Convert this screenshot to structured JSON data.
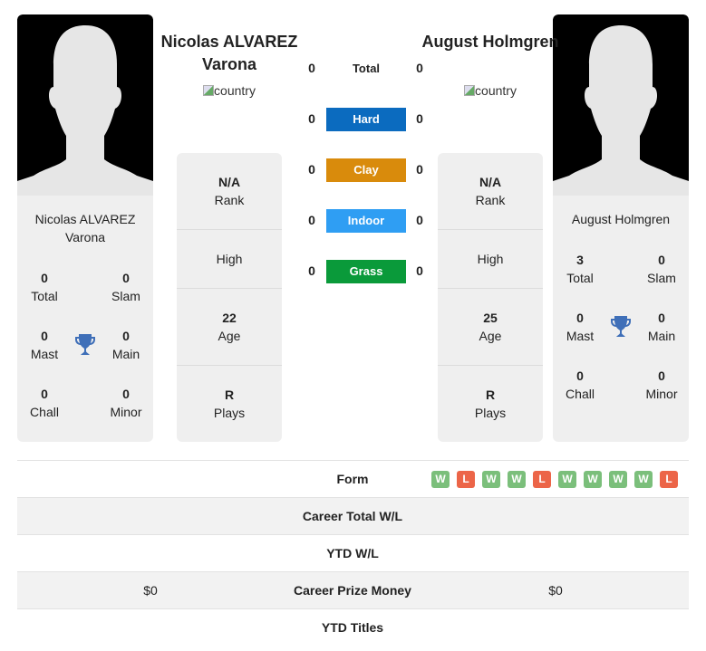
{
  "colors": {
    "hard": "#0b6bbf",
    "clay": "#d98b0c",
    "indoor": "#2f9ef3",
    "grass": "#0a9a3a",
    "win": "#7bbf7b",
    "loss": "#ec6548",
    "trophy": "#3f6fb8"
  },
  "player_left": {
    "name": "Nicolas ALVAREZ Varona",
    "country_alt": "country",
    "card_name": "Nicolas ALVAREZ Varona",
    "stats": {
      "total": {
        "value": "0",
        "label": "Total"
      },
      "slam": {
        "value": "0",
        "label": "Slam"
      },
      "mast": {
        "value": "0",
        "label": "Mast"
      },
      "main": {
        "value": "0",
        "label": "Main"
      },
      "chall": {
        "value": "0",
        "label": "Chall"
      },
      "minor": {
        "value": "0",
        "label": "Minor"
      }
    },
    "info": {
      "rank": {
        "value": "N/A",
        "label": "Rank"
      },
      "high": {
        "value": "",
        "label": "High"
      },
      "age": {
        "value": "22",
        "label": "Age"
      },
      "plays": {
        "value": "R",
        "label": "Plays"
      }
    }
  },
  "player_right": {
    "name": "August Holmgren",
    "country_alt": "country",
    "card_name": "August Holmgren",
    "stats": {
      "total": {
        "value": "3",
        "label": "Total"
      },
      "slam": {
        "value": "0",
        "label": "Slam"
      },
      "mast": {
        "value": "0",
        "label": "Mast"
      },
      "main": {
        "value": "0",
        "label": "Main"
      },
      "chall": {
        "value": "0",
        "label": "Chall"
      },
      "minor": {
        "value": "0",
        "label": "Minor"
      }
    },
    "info": {
      "rank": {
        "value": "N/A",
        "label": "Rank"
      },
      "high": {
        "value": "",
        "label": "High"
      },
      "age": {
        "value": "25",
        "label": "Age"
      },
      "plays": {
        "value": "R",
        "label": "Plays"
      }
    }
  },
  "h2h": [
    {
      "label": "Total",
      "left": "0",
      "right": "0",
      "surface": "total"
    },
    {
      "label": "Hard",
      "left": "0",
      "right": "0",
      "surface": "hard"
    },
    {
      "label": "Clay",
      "left": "0",
      "right": "0",
      "surface": "clay"
    },
    {
      "label": "Indoor",
      "left": "0",
      "right": "0",
      "surface": "indoor"
    },
    {
      "label": "Grass",
      "left": "0",
      "right": "0",
      "surface": "grass"
    }
  ],
  "table": {
    "form_label": "Form",
    "form_right": [
      "W",
      "L",
      "W",
      "W",
      "L",
      "W",
      "W",
      "W",
      "W",
      "L"
    ],
    "rows": [
      {
        "label": "Career Total W/L",
        "left": "",
        "right": ""
      },
      {
        "label": "YTD W/L",
        "left": "",
        "right": ""
      },
      {
        "label": "Career Prize Money",
        "left": "$0",
        "right": "$0"
      },
      {
        "label": "YTD Titles",
        "left": "",
        "right": ""
      }
    ]
  }
}
